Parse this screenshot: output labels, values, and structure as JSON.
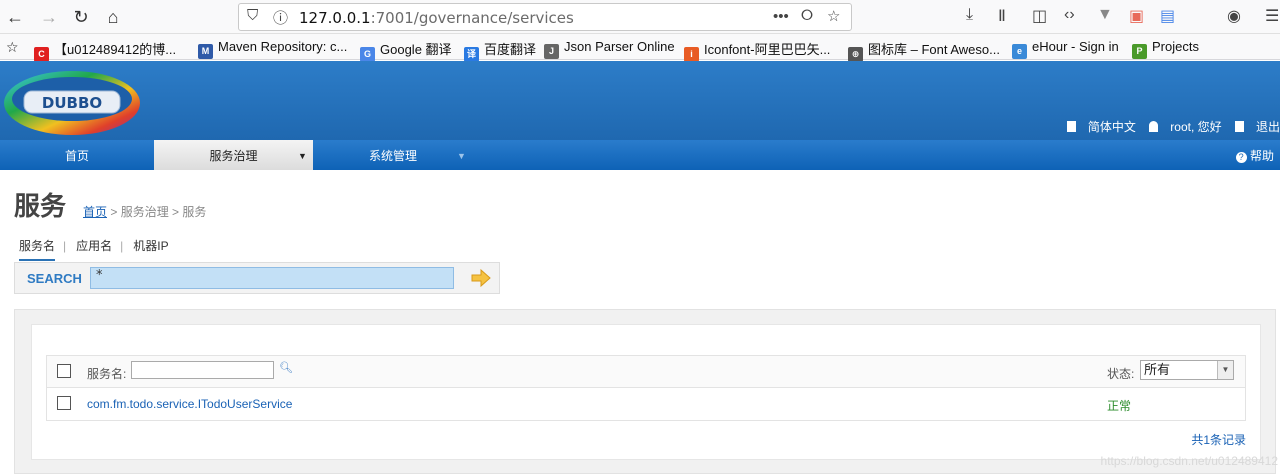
{
  "browser": {
    "url_host": "127.0.0.1",
    "url_rest": ":7001/governance/services",
    "more": "•••",
    "bookmarks": [
      {
        "label": "【u012489412的博...",
        "icon": "csdn-icon",
        "color": "#e02020",
        "glyph": "C"
      },
      {
        "label": "Maven Repository: c...",
        "icon": "maven-icon",
        "color": "#2f5aa8",
        "glyph": "MVN"
      },
      {
        "label": "Google 翻译",
        "icon": "google-translate-icon",
        "color": "#4a86e8",
        "glyph": "G"
      },
      {
        "label": "百度翻译",
        "icon": "baidu-translate-icon",
        "color": "#2a7ae2",
        "glyph": "译"
      },
      {
        "label": "Json Parser Online",
        "icon": "json-icon",
        "color": "#666666",
        "glyph": "J"
      },
      {
        "label": "Iconfont-阿里巴巴矢...",
        "icon": "iconfont-icon",
        "color": "#e85b24",
        "glyph": "i"
      },
      {
        "label": "图标库 – Font Aweso...",
        "icon": "globe-icon",
        "color": "#555555",
        "glyph": "⊕"
      },
      {
        "label": "eHour - Sign in",
        "icon": "ehour-icon",
        "color": "#3a8ad8",
        "glyph": "e"
      },
      {
        "label": "Projects",
        "icon": "projects-icon",
        "color": "#4a9a2a",
        "glyph": "P"
      }
    ]
  },
  "app": {
    "logo_text": "DUBBO",
    "user": {
      "language": "简体中文",
      "greeting": "root, 您好",
      "logout": "退出"
    },
    "nav": {
      "home": "首页",
      "governance": "服务治理",
      "system": "系统管理",
      "help": "帮助"
    }
  },
  "page": {
    "title": "服务",
    "breadcrumb": {
      "home": "首页",
      "rest": " > 服务治理 > 服务"
    },
    "subtabs": [
      "服务名",
      "应用名",
      "机器IP"
    ],
    "search": {
      "label": "SEARCH",
      "value": "*"
    },
    "table": {
      "filter_label": "服务名:",
      "status_label": "状态:",
      "status_value": "所有",
      "rows": [
        {
          "service": "com.fm.todo.service.ITodoUserService",
          "status": "正常"
        }
      ]
    },
    "total": "共1条记录"
  },
  "watermark": "https://blog.csdn.net/u012489412",
  "colors": {
    "brand": "#2b79c3",
    "link": "#1a62b5",
    "ok": "#2d8c2d"
  }
}
